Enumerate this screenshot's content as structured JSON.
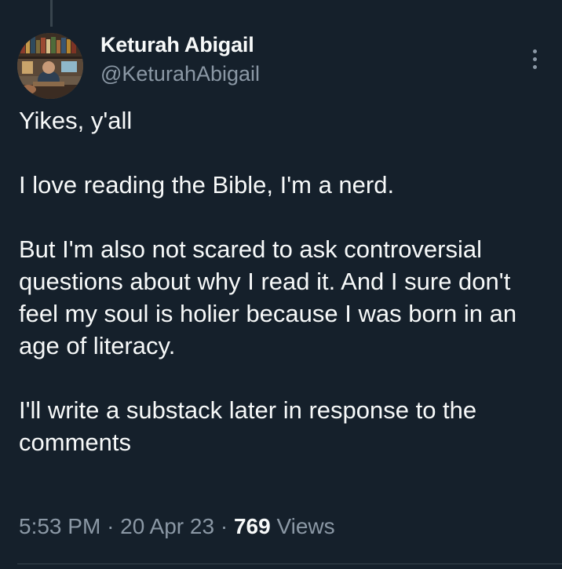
{
  "author": {
    "display_name": "Keturah Abigail",
    "handle": "@KeturahAbigail",
    "avatar_icon": "profile-photo-icon"
  },
  "tweet": {
    "paragraphs": [
      "Yikes, y'all",
      "I love reading the Bible, I'm a nerd.",
      "But I'm also not scared to ask controversial questions about why I read it. And I sure don't feel my soul is holier because I was born in an age of literacy.",
      "I'll write a substack later in response to the comments"
    ]
  },
  "meta": {
    "time": "5:53 PM",
    "separator": "·",
    "date": "20 Apr 23",
    "views_count": "769",
    "views_label": "Views"
  },
  "icons": {
    "more": "more-options-icon"
  },
  "colors": {
    "background": "#15202b",
    "primary_text": "#f7f9f9",
    "secondary_text": "#8b98a5",
    "divider": "#38444d"
  }
}
